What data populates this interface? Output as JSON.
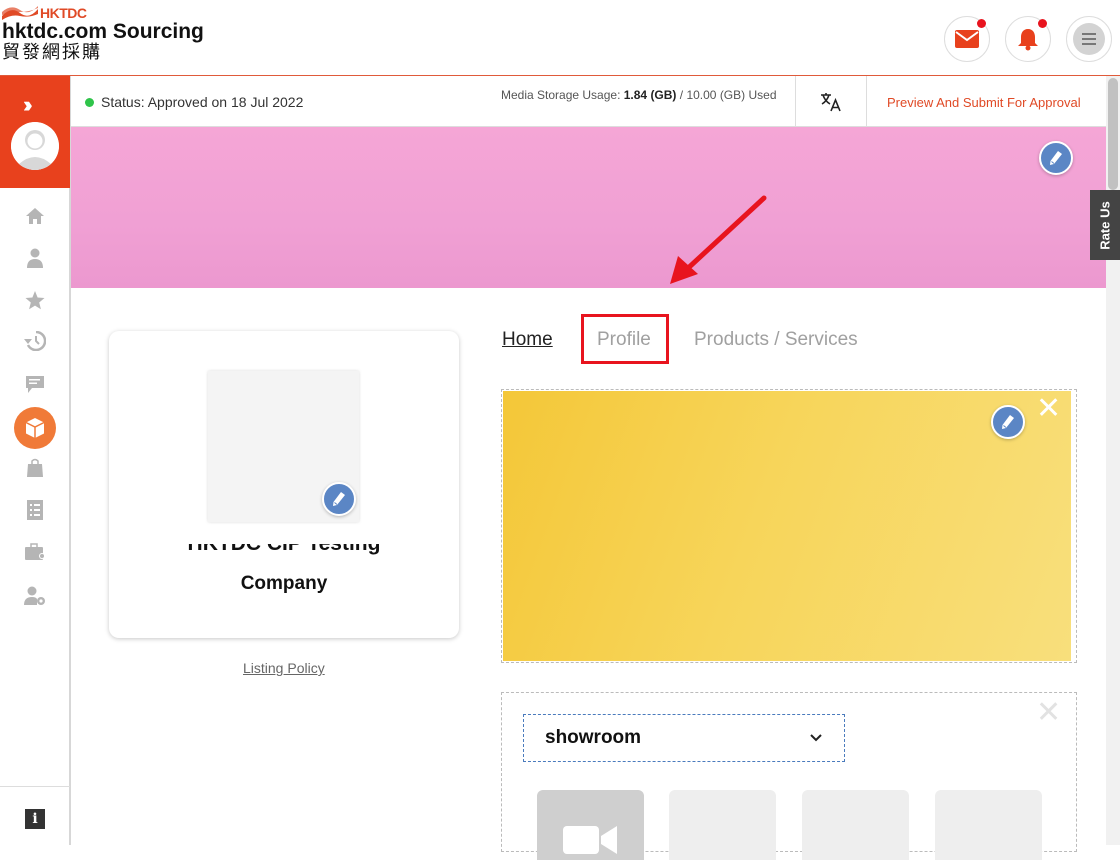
{
  "header": {
    "logo_mark": "HKTDC",
    "title": "hktdc.com Sourcing",
    "subtitle": "貿發網採購",
    "mail_icon": "mail-icon",
    "bell_icon": "bell-icon",
    "menu_icon": "menu-icon",
    "accent": "#e8411d"
  },
  "statusbar": {
    "status_text": "Status: Approved on 18 Jul 2022",
    "storage_label": "Media Storage Usage:",
    "storage_used": "1.84 (GB)",
    "storage_total": "/ 10.00 (GB) Used",
    "preview_link": "Preview And Submit For Approval"
  },
  "rate_us": "Rate Us",
  "company": {
    "name_line1": "HKTDC CIP Testing",
    "name_line2": "Company",
    "listing_policy": "Listing Policy"
  },
  "tabs": [
    {
      "label": "Home"
    },
    {
      "label": "Profile"
    },
    {
      "label": "Products / Services"
    }
  ],
  "showroom": {
    "selected": "showroom"
  },
  "sidebar": {
    "icons": [
      "home-icon",
      "user-icon",
      "star-icon",
      "history-icon",
      "message-icon",
      "box-icon",
      "bag-icon",
      "checklist-icon",
      "briefcase-icon",
      "user-settings-icon",
      "info-icon"
    ]
  }
}
